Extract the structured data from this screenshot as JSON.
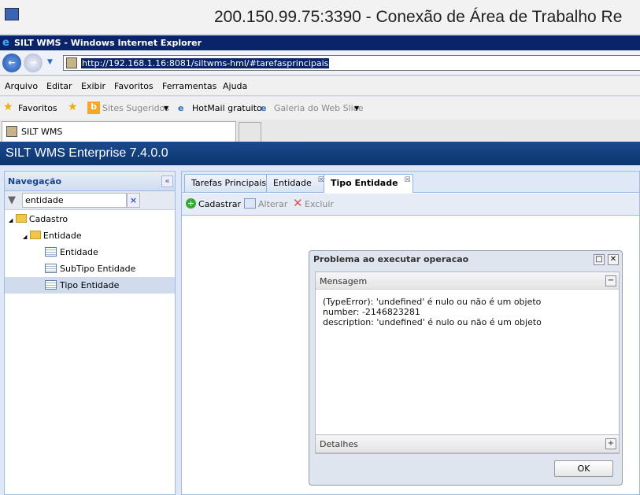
{
  "rdp": {
    "title": "200.150.99.75:3390 - Conexão de Área de Trabalho Re"
  },
  "ie": {
    "window_title": "SILT WMS - Windows Internet Explorer",
    "url": "http://192.168.1.16:8081/siltwms-hml/#tarefasprincipais",
    "menu": [
      "Arquivo",
      "Editar",
      "Exibir",
      "Favoritos",
      "Ferramentas",
      "Ajuda"
    ],
    "favorites": {
      "label": "Favoritos",
      "items": [
        "Sites Sugeridos",
        "HotMail gratuito",
        "Galeria do Web Slice"
      ]
    },
    "tab": "SILT WMS"
  },
  "app": {
    "title": "SILT WMS Enterprise 7.4.0.0"
  },
  "nav": {
    "title": "Navegação",
    "filter": "entidade",
    "tree": [
      {
        "label": "Cadastro",
        "type": "folder"
      },
      {
        "label": "Entidade",
        "type": "folder"
      },
      {
        "label": "Entidade",
        "type": "leaf"
      },
      {
        "label": "SubTipo Entidade",
        "type": "leaf"
      },
      {
        "label": "Tipo Entidade",
        "type": "leaf",
        "selected": true
      }
    ]
  },
  "main": {
    "tabs": [
      {
        "label": "Tarefas Principais"
      },
      {
        "label": "Entidade"
      },
      {
        "label": "Tipo Entidade",
        "active": true
      }
    ],
    "toolbar": {
      "add": "Cadastrar",
      "edit": "Alterar",
      "delete": "Excluir"
    }
  },
  "dialog": {
    "title": "Problema ao executar operacao",
    "message_header": "Mensagem",
    "lines": [
      "(TypeError): 'undefined' é nulo ou não é um objeto",
      "number: -2146823281",
      "description: 'undefined' é nulo ou não é um objeto"
    ],
    "details_header": "Detalhes",
    "ok": "OK"
  }
}
